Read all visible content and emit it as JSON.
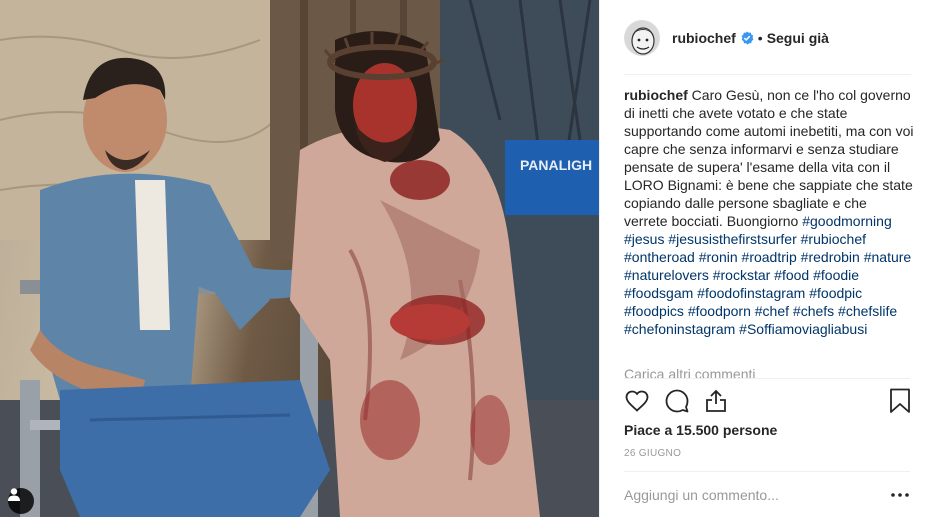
{
  "post": {
    "username": "rubiochef",
    "follow_label": "Segui già",
    "separator": "•",
    "verified_icon": "verified-badge-icon",
    "caption_user": "rubiochef",
    "caption_text": "Caro Gesù, non ce l'ho col governo di inetti che avete votato e che state supportando come automi inebetiti, ma con voi capre che senza informarvi e senza studiare pensate de supera' l'esame della vita con il LORO Bignami: è bene che sappiate che state copiando dalle persone sbagliate e che verrete bocciati. Buongiorno",
    "caption_hashtags": "#goodmorning #jesus #jesusisthefirstsurfer #rubiochef #ontheroad #ronin #roadtrip #redrobin #nature #naturelovers #rockstar #food #foodie #foodsgam #foodofinstagram #foodpic #foodpics #foodporn #chef #chefs #chefslife #chefoninstagram #Soffiamoviagliabusi",
    "more_comments_label": "Carica altri commenti",
    "likes_label": "Piace a 15.500 persone",
    "date_label": "26 GIUGNO",
    "comment_placeholder": "Aggiungi un commento...",
    "more_icon": "more-options-icon"
  },
  "photo": {
    "chair_print": "PANALIGH"
  },
  "colors": {
    "text": "#262626",
    "muted": "#999999",
    "hashtag": "#003569",
    "verified": "#3897f0",
    "divider": "#efefef"
  }
}
